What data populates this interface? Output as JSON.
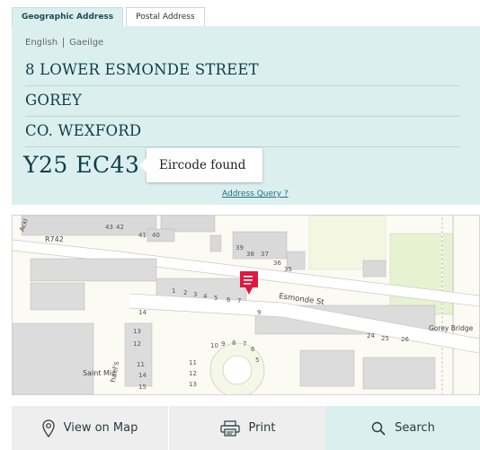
{
  "tabs": [
    {
      "label": "Geographic Address",
      "active": true
    },
    {
      "label": "Postal Address",
      "active": false
    }
  ],
  "language": {
    "english": "English",
    "irish": "Gaeilge"
  },
  "address": {
    "line1": "8 LOWER ESMONDE STREET",
    "line2": "GOREY",
    "line3": "CO. WEXFORD"
  },
  "eircode": "Y25 EC43",
  "status_message": "Eircode found",
  "address_query_link": "Address Query ?",
  "map": {
    "labels": {
      "road_r742": "R742",
      "street": "Esmonde St",
      "bridge": "Gorey Bridge",
      "saint": "Saint Mic",
      "saint2": "hael's",
      "ackl": "Ackl"
    },
    "house_numbers": [
      "43",
      "42",
      "41",
      "40",
      "39",
      "38",
      "37",
      "36",
      "35",
      "1",
      "2",
      "3",
      "4",
      "5",
      "6",
      "7",
      "9",
      "14",
      "24",
      "25",
      "26",
      "13",
      "12",
      "11",
      "10",
      "9",
      "8",
      "7",
      "6",
      "5",
      "11",
      "12",
      "13",
      "14",
      "15"
    ],
    "pin_color": "#e0173f"
  },
  "buttons": {
    "view_on_map": "View on Map",
    "print": "Print",
    "search": "Search"
  },
  "colors": {
    "panel_bg": "#dcefef",
    "text_dark": "#0e3d47",
    "link": "#1b6f7f"
  }
}
